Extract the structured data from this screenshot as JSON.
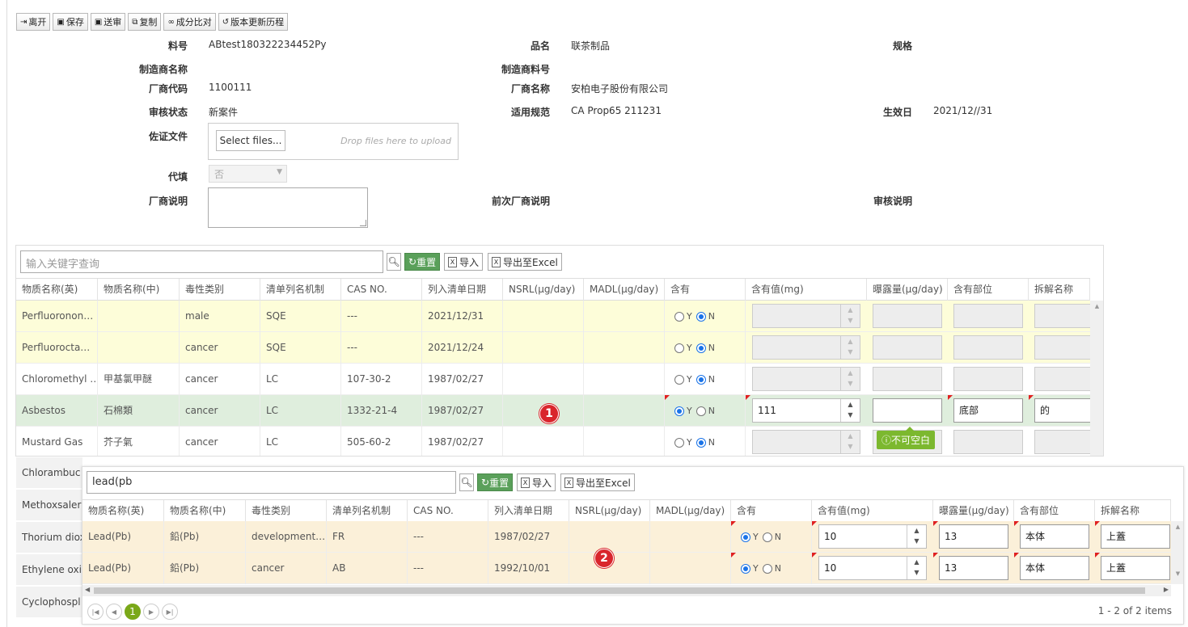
{
  "toolbar": {
    "leave": "离开",
    "save": "保存",
    "submit": "送审",
    "copy": "复制",
    "compare": "成分比对",
    "history": "版本更新历程"
  },
  "form": {
    "part_no_label": "料号",
    "part_no": "ABtest180322234452Py",
    "product_name_label": "品名",
    "product_name": "联茶制品",
    "spec_label": "规格",
    "mfr_name_label": "制造商名称",
    "mfr_part_label": "制造商料号",
    "vendor_code_label": "厂商代码",
    "vendor_code": "1100111",
    "vendor_name_label": "厂商名称",
    "vendor_name": "安柏电子股份有限公司",
    "review_status_label": "审核状态",
    "review_status": "新案件",
    "regulation_label": "适用规范",
    "regulation": "CA Prop65 211231",
    "effective_label": "生效日",
    "effective_date": "2021/12//31",
    "evidence_label": "佐证文件",
    "select_files": "Select files...",
    "drop_hint": "Drop files here to upload",
    "proxy_label": "代填",
    "proxy_value": "否",
    "vendor_note_label": "厂商说明",
    "prev_note_label": "前次厂商说明",
    "review_note_label": "审核说明"
  },
  "grid1": {
    "search_placeholder": "输入关键字查询",
    "reset": "重置",
    "import": "导入",
    "export": "导出至Excel",
    "columns": [
      "物质名称(英)",
      "物质名称(中)",
      "毒性类别",
      "清单列名机制",
      "CAS NO.",
      "列入清单日期",
      "NSRL(μg/day)",
      "MADL(μg/day)",
      "含有",
      "含有值(mg)",
      "曝露量(μg/day)",
      "含有部位",
      "拆解名称"
    ],
    "rows": [
      {
        "en": "Perfluoronon…",
        "zh": "",
        "tox": "male",
        "mech": "SQE",
        "cas": "---",
        "date": "2021/12/31",
        "contain": "N",
        "amount": "",
        "exposure": "",
        "part": "",
        "dis": ""
      },
      {
        "en": "Perfluorocta…",
        "zh": "",
        "tox": "cancer",
        "mech": "SQE",
        "cas": "---",
        "date": "2021/12/24",
        "contain": "N",
        "amount": "",
        "exposure": "",
        "part": "",
        "dis": ""
      },
      {
        "en": "Chloromethyl …",
        "zh": "甲基氯甲醚",
        "tox": "cancer",
        "mech": "LC",
        "cas": "107-30-2",
        "date": "1987/02/27",
        "contain": "N",
        "amount": "",
        "exposure": "",
        "part": "",
        "dis": ""
      },
      {
        "en": "Asbestos",
        "zh": "石棉類",
        "tox": "cancer",
        "mech": "LC",
        "cas": "1332-21-4",
        "date": "1987/02/27",
        "contain": "Y",
        "amount": "111",
        "exposure": "",
        "part": "底部",
        "dis": "的"
      },
      {
        "en": "Mustard Gas",
        "zh": "芥子氣",
        "tox": "cancer",
        "mech": "LC",
        "cas": "505-60-2",
        "date": "1987/02/27",
        "contain": "N",
        "amount": "",
        "exposure": "",
        "part": "",
        "dis": ""
      }
    ],
    "peek_rows": [
      "Chlorambuc",
      "Methoxsaler",
      "Thorium diox",
      "Ethylene oxi",
      "Cyclophospl"
    ],
    "tooltip": "不可空白",
    "radio_y": "Y",
    "radio_n": "N",
    "badge": "1"
  },
  "grid2": {
    "search_value": "lead(pb",
    "reset": "重置",
    "import": "导入",
    "export": "导出至Excel",
    "columns": [
      "物质名称(英)",
      "物质名称(中)",
      "毒性类别",
      "清单列名机制",
      "CAS NO.",
      "列入清单日期",
      "NSRL(μg/day)",
      "MADL(μg/day)",
      "含有",
      "含有值(mg)",
      "曝露量(μg/day)",
      "含有部位",
      "拆解名称"
    ],
    "rows": [
      {
        "en": "Lead(Pb)",
        "zh": "鉛(Pb)",
        "tox": "development…",
        "mech": "FR",
        "cas": "---",
        "date": "1987/02/27",
        "contain": "Y",
        "amount": "10",
        "exposure": "13",
        "part": "本体",
        "dis": "上蓋"
      },
      {
        "en": "Lead(Pb)",
        "zh": "鉛(Pb)",
        "tox": "cancer",
        "mech": "AB",
        "cas": "---",
        "date": "1992/10/01",
        "contain": "Y",
        "amount": "10",
        "exposure": "13",
        "part": "本体",
        "dis": "上蓋"
      }
    ],
    "radio_y": "Y",
    "radio_n": "N",
    "badge": "2",
    "current_page": "1",
    "pager_info": "1 - 2 of 2 items"
  }
}
